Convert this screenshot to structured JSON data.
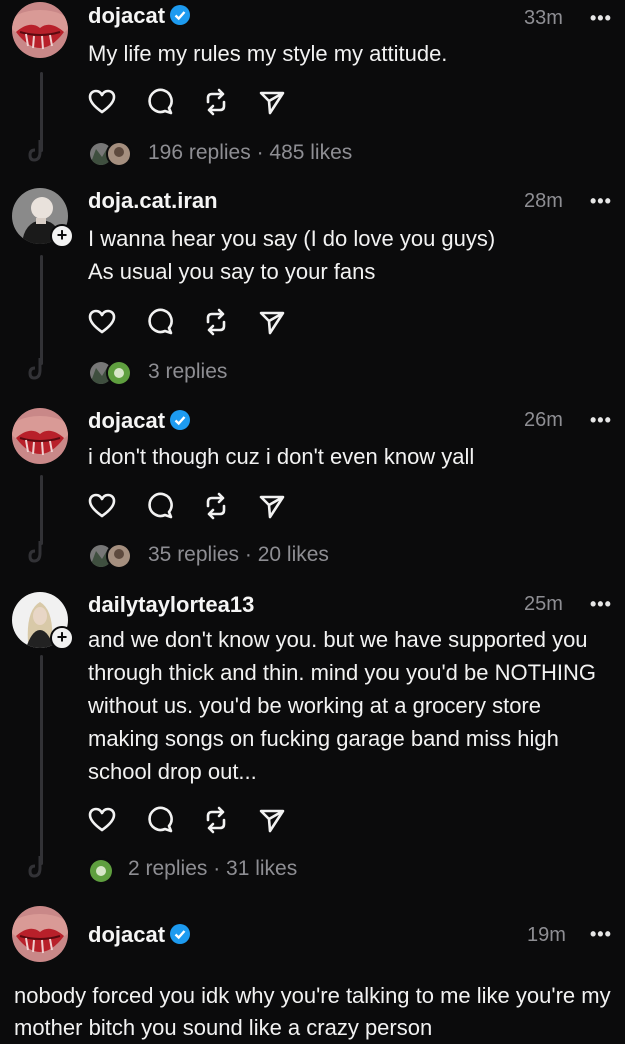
{
  "posts": [
    {
      "username": "dojacat",
      "verified": true,
      "time": "33m",
      "text": "My life my rules my style my attitude.",
      "stats": "196 replies · 485 likes",
      "avatar": "lips-avatar"
    },
    {
      "username": "doja.cat.iran",
      "verified": false,
      "time": "28m",
      "text": "I wanna hear you say (I do love you guys)\nAs usual you say to your fans",
      "stats": "3 replies",
      "avatar": "photo-avatar"
    },
    {
      "username": "dojacat",
      "verified": true,
      "time": "26m",
      "text": "i don't though cuz i don't even know yall",
      "stats": "35 replies · 20 likes",
      "avatar": "lips-avatar"
    },
    {
      "username": "dailytaylortea13",
      "verified": false,
      "time": "25m",
      "text": "and we don't know you. but we have supported you through thick and thin. mind you you'd be NOTHING without us. you'd be working at a grocery store making songs on fucking garage band miss high school drop out...",
      "stats": "2 replies · 31 likes",
      "avatar": "photo-avatar"
    },
    {
      "username": "dojacat",
      "verified": true,
      "time": "19m",
      "text": "nobody forced you idk why you're talking to me like you're my mother bitch you sound like a crazy person",
      "avatar": "lips-avatar"
    }
  ],
  "more_label": "•••",
  "icons": [
    "heart-icon",
    "comment-icon",
    "repost-icon",
    "share-icon",
    "more-icon",
    "verified-icon",
    "follow-plus-icon"
  ],
  "colors": {
    "background": "#0b0b0c",
    "text": "#f2f2f2",
    "muted": "#8e8e93",
    "verified": "#1d9bf0",
    "thread_line": "#323236"
  }
}
